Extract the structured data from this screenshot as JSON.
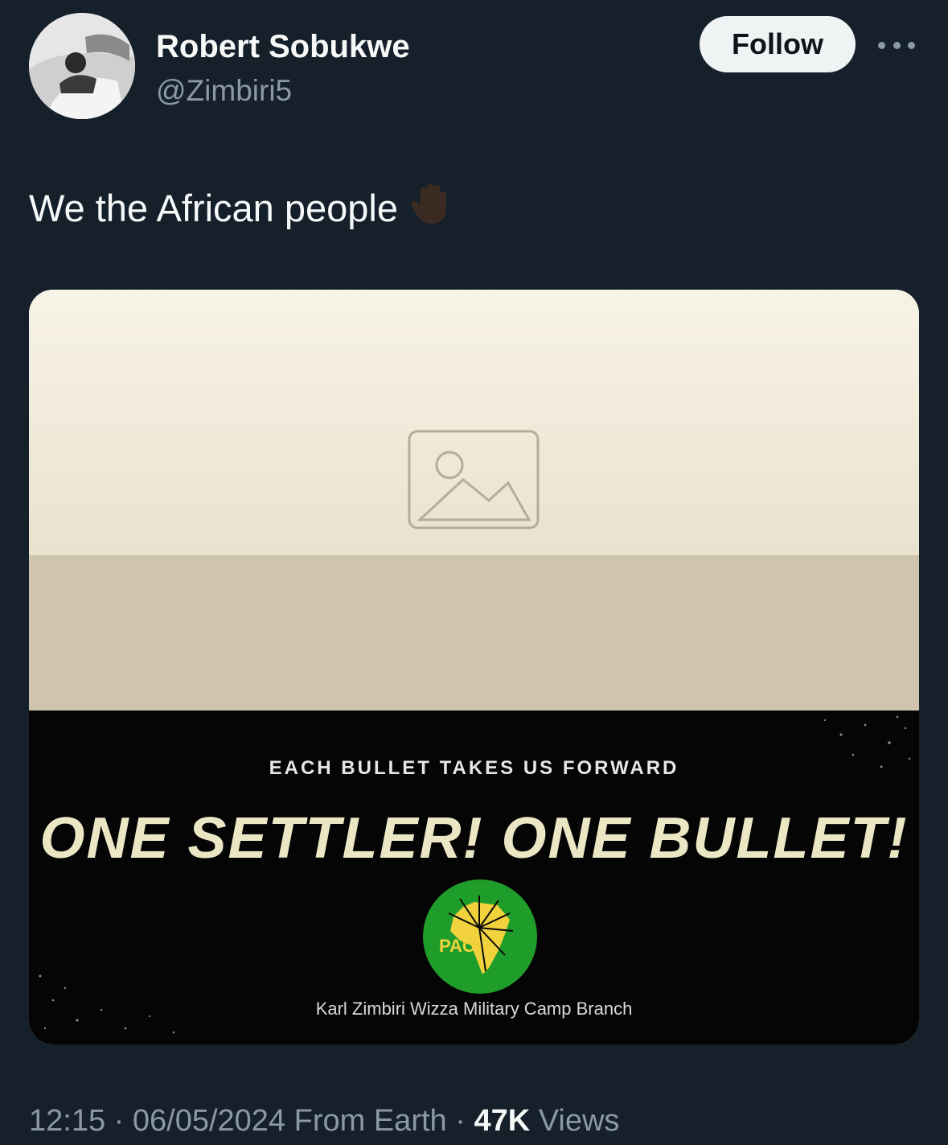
{
  "tweet": {
    "author": {
      "display_name": "Robert Sobukwe",
      "handle": "@Zimbiri5",
      "avatar_icon": "avatar"
    },
    "follow_label": "Follow",
    "more_icon": "more-horizontal-icon",
    "text": "We the African people",
    "emoji": "raised-hand-emoji",
    "media": {
      "banner_subtitle": "EACH BULLET TAKES US FORWARD",
      "banner_title": "ONE SETTLER! ONE BULLET!",
      "logo_text": "PAC",
      "branch_text": "Karl Zimbiri Wizza Military Camp Branch"
    },
    "meta": {
      "time": "12:15",
      "date": "06/05/2024",
      "source": "From Earth",
      "views_count": "47K",
      "views_label": "Views"
    }
  },
  "colors": {
    "background": "#15202b",
    "primary_text": "#f7f9f9",
    "secondary_text": "#8b98a5",
    "follow_button": "#eff3f4",
    "logo_green": "#1f9d2a",
    "logo_yellow": "#f1d23c"
  }
}
